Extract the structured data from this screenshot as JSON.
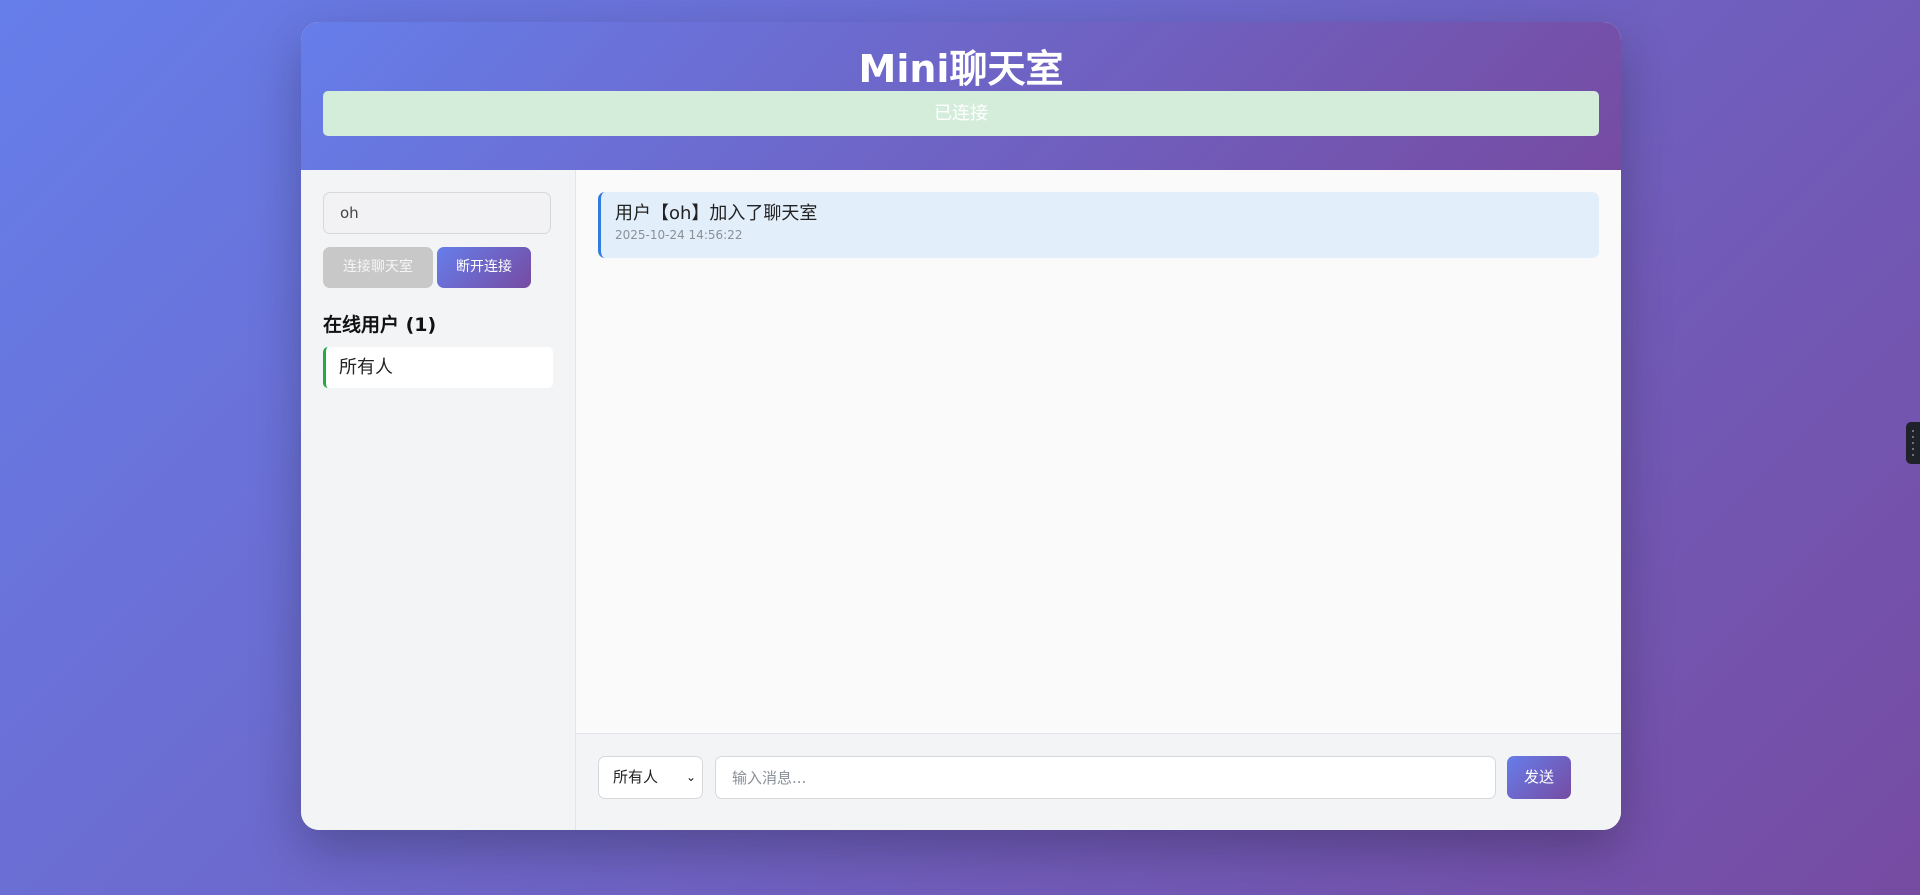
{
  "header": {
    "title": "Mini聊天室",
    "status": "已连接",
    "status_color": "#d4edda"
  },
  "sidebar": {
    "username_value": "oh",
    "connect_label": "连接聊天室",
    "disconnect_label": "断开连接",
    "online_title": "在线用户 (1)",
    "users": [
      {
        "label": "所有人"
      }
    ]
  },
  "messages": [
    {
      "text": "用户【oh】加入了聊天室",
      "time": "2025-10-24 14:56:22"
    }
  ],
  "composer": {
    "recipient_selected": "所有人",
    "message_placeholder": "输入消息...",
    "send_label": "发送"
  },
  "theme": {
    "gradient_start": "#667eea",
    "gradient_end": "#764ba2",
    "online_accent": "#28a745",
    "message_accent": "#2f7de1"
  }
}
